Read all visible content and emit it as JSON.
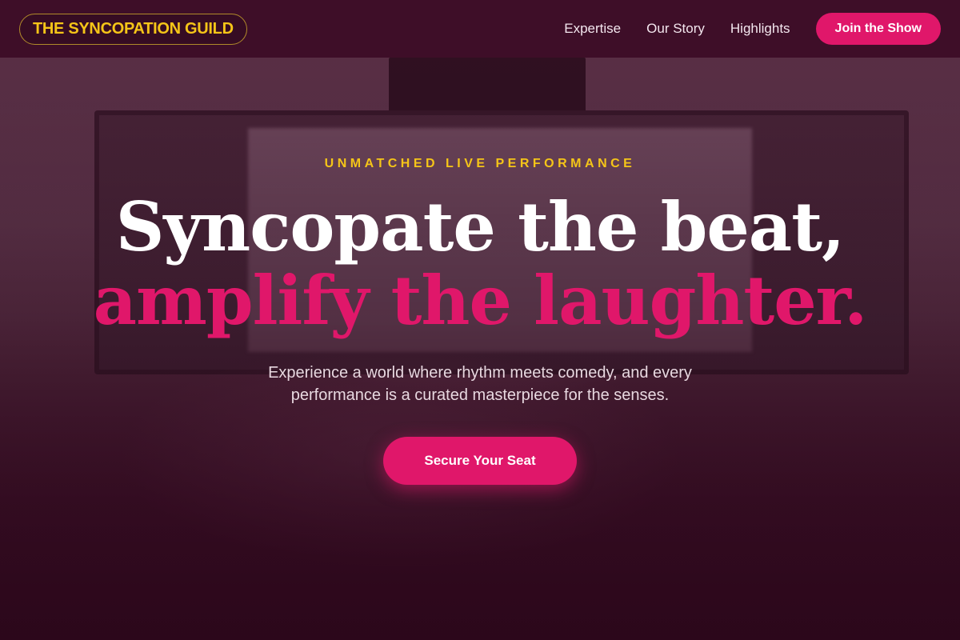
{
  "brand": {
    "name": "THE SYNCOPATION GUILD"
  },
  "nav": {
    "links": [
      "Expertise",
      "Our Story",
      "Highlights"
    ],
    "cta_label": "Join the Show"
  },
  "hero": {
    "eyebrow": "UNMATCHED LIVE PERFORMANCE",
    "headline_line1": "Syncopate the beat,",
    "headline_line2": "amplify the laughter.",
    "subtext": "Experience a world where rhythm meets comedy, and every performance is a curated masterpiece for the senses.",
    "cta_label": "Secure Your Seat"
  },
  "colors": {
    "accent": "#e0176a",
    "brand_gold": "#f5c518",
    "header_bg": "#3a0a24"
  }
}
